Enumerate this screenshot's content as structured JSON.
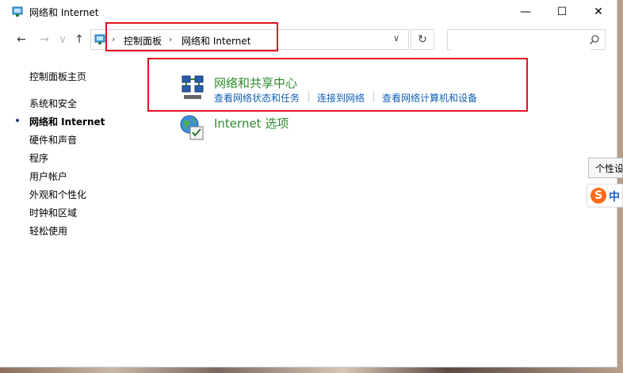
{
  "window": {
    "title": "网络和 Internet"
  },
  "titlebar": {
    "minimize": "—",
    "maximize": "☐",
    "close": "✕"
  },
  "nav": {
    "back": "←",
    "forward": "→",
    "up": "↑"
  },
  "address": {
    "crumbs": [
      "控制面板",
      "网络和 Internet"
    ],
    "separator": "›",
    "dropdown": "∨",
    "refresh": "↻"
  },
  "search": {
    "placeholder": "",
    "value": ""
  },
  "sidebar": {
    "home": "控制面板主页",
    "items": [
      {
        "label": "系统和安全",
        "active": false
      },
      {
        "label": "网络和 Internet",
        "active": true
      },
      {
        "label": "硬件和声音",
        "active": false
      },
      {
        "label": "程序",
        "active": false
      },
      {
        "label": "用户帐户",
        "active": false
      },
      {
        "label": "外观和个性化",
        "active": false
      },
      {
        "label": "时钟和区域",
        "active": false
      },
      {
        "label": "轻松使用",
        "active": false
      }
    ]
  },
  "categories": [
    {
      "title": "网络和共享中心",
      "icon": "network-sharing-center-icon",
      "links": [
        "查看网络状态和任务",
        "连接到网络",
        "查看网络计算机和设备"
      ]
    },
    {
      "title": "Internet 选项",
      "icon": "internet-options-icon",
      "links": []
    }
  ],
  "tooltip": {
    "text": "个性设"
  },
  "ime": {
    "logo": "S",
    "mode": "中"
  },
  "colors": {
    "highlight": "#e0121f",
    "link": "#0f5fb5",
    "category_title": "#2e8b2e"
  }
}
